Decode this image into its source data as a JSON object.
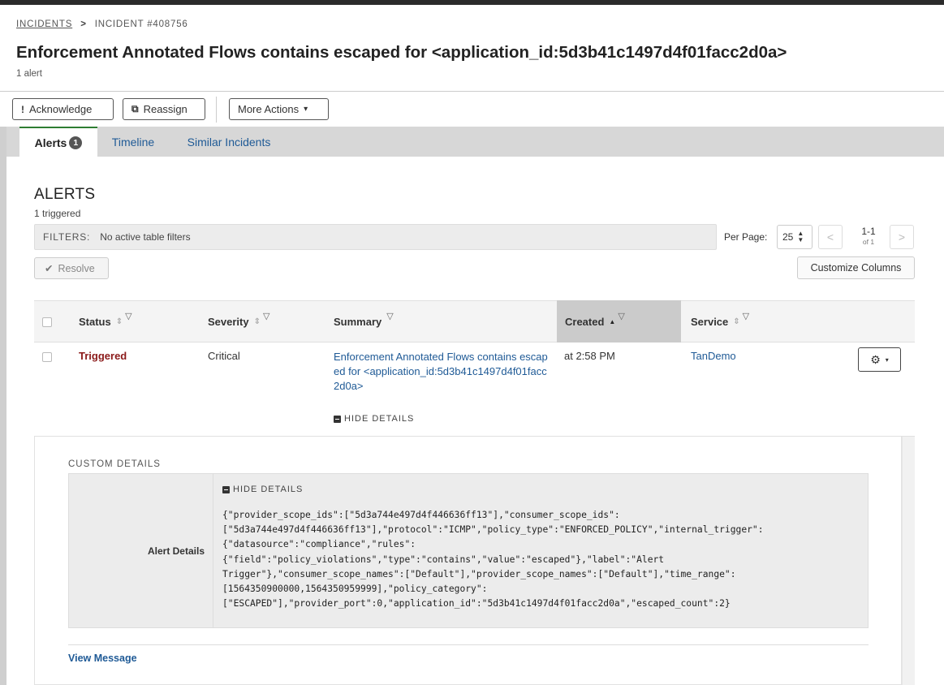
{
  "breadcrumb": {
    "root": "INCIDENTS",
    "separator": ">",
    "current": "INCIDENT #408756"
  },
  "page": {
    "title": "Enforcement Annotated Flows contains escaped for <application_id:5d3b41c1497d4f01facc2d0a>",
    "subtitle": "1 alert"
  },
  "toolbar": {
    "acknowledge": {
      "icon": "!",
      "label": "Acknowledge"
    },
    "reassign": {
      "icon": "⧉",
      "label": "Reassign"
    },
    "more_actions": {
      "label": "More Actions",
      "caret": "▾"
    }
  },
  "tabs": [
    {
      "label": "Alerts",
      "count": "1",
      "active": true
    },
    {
      "label": "Timeline",
      "active": false
    },
    {
      "label": "Similar Incidents",
      "active": false
    }
  ],
  "alerts": {
    "title": "ALERTS",
    "subtitle": "1 triggered",
    "filters_label": "FILTERS:",
    "filters_value": "No active table filters",
    "per_page_label": "Per Page:",
    "per_page_value": "25",
    "pager_range": "1-1",
    "pager_of": "of 1",
    "prev_glyph": "<",
    "next_glyph": ">",
    "resolve_label": "Resolve",
    "customize_label": "Customize Columns",
    "columns": [
      "Status",
      "Severity",
      "Summary",
      "Created",
      "Service"
    ],
    "sort_glyph": "⇕",
    "sort_active_glyph": "▲",
    "filter_glyph": "▽",
    "rows": [
      {
        "status": "Triggered",
        "severity": "Critical",
        "summary": "Enforcement Annotated Flows contains escaped for <application_id:5d3b41c1497d4f01facc2d0a>",
        "created": "at 2:58 PM",
        "service": "TanDemo"
      }
    ],
    "row_hide_details": "HIDE DETAILS",
    "gear_glyph": "⚙",
    "gear_caret": "▾"
  },
  "details": {
    "title": "CUSTOM DETAILS",
    "label": "Alert Details",
    "hide_details": "HIDE DETAILS",
    "json_lines": [
      "{\"provider_scope_ids\":[\"5d3a744e497d4f446636ff13\"],\"consumer_scope_ids\":",
      "[\"5d3a744e497d4f446636ff13\"],\"protocol\":\"ICMP\",\"policy_type\":\"ENFORCED_POLICY\",\"internal_trigger\":",
      "{\"datasource\":\"compliance\",\"rules\":",
      "{\"field\":\"policy_violations\",\"type\":\"contains\",\"value\":\"escaped\"},\"label\":\"Alert",
      "Trigger\"},\"consumer_scope_names\":[\"Default\"],\"provider_scope_names\":[\"Default\"],\"time_range\":",
      "[1564350900000,1564350959999],\"policy_category\":",
      "[\"ESCAPED\"],\"provider_port\":0,\"application_id\":\"5d3b41c1497d4f01facc2d0a\",\"escaped_count\":2}"
    ],
    "view_message": "View Message"
  }
}
